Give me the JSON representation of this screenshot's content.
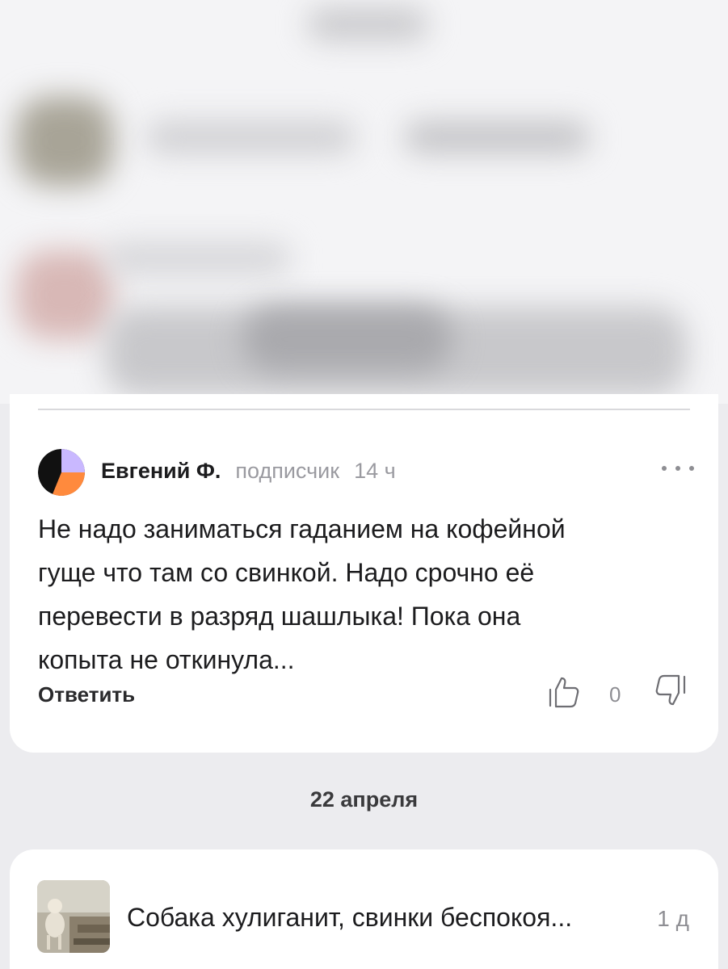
{
  "comment": {
    "author_name": "Евгений Ф.",
    "author_role": "подписчик",
    "time": "14 ч",
    "text_lines": [
      "Не надо заниматься гаданием на кофейной",
      "гуще что там со свинкой. Надо срочно её",
      "перевести в разряд шашлыка! Пока она",
      "копыта не откинула..."
    ],
    "reply_label": "Ответить",
    "like_count": "0",
    "icons": {
      "avatar": "avatar-icon",
      "more": "more-dots-icon",
      "like": "thumbs-up-icon",
      "dislike": "thumbs-down-icon"
    },
    "avatar_colors": [
      "#111111",
      "#ff8a3d",
      "#c9b8ff"
    ]
  },
  "date_separator": "22 апреля",
  "notification": {
    "text": "Собака хулиганит, свинки беспокоя...",
    "time": "1 д"
  },
  "colors": {
    "background": "#ececef",
    "card": "#ffffff",
    "muted_text": "#9a9aa0"
  }
}
